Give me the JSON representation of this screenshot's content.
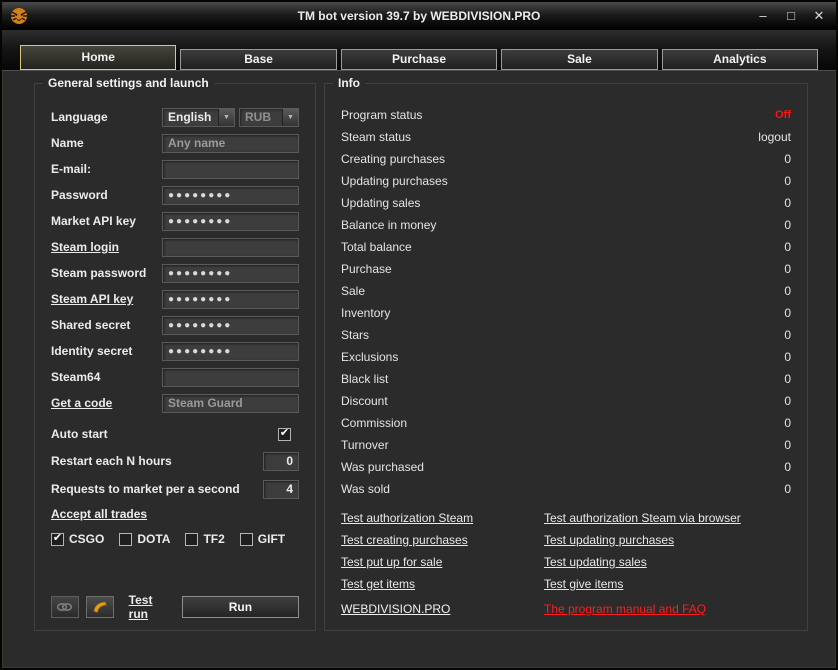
{
  "window": {
    "title": "TM bot version 39.7 by WEBDIVISION.PRO"
  },
  "icons": {
    "minimize": "–",
    "maximize": "□",
    "close": "✕",
    "dropdown_arrow": "▼",
    "check": "✔"
  },
  "tabs": [
    "Home",
    "Base",
    "Purchase",
    "Sale",
    "Analytics"
  ],
  "settings": {
    "title": "General settings and launch",
    "language_label": "Language",
    "language_value": "English",
    "currency_value": "RUB",
    "name_label": "Name",
    "name_value": "Any name",
    "email_label": "E-mail:",
    "email_value": "",
    "password_label": "Password",
    "password_value": "●●●●●●●●",
    "market_api_label": "Market API key",
    "market_api_value": "●●●●●●●●",
    "steam_login_label": "Steam login",
    "steam_login_value": "",
    "steam_password_label": "Steam password",
    "steam_password_value": "●●●●●●●●",
    "steam_api_label": "Steam API key",
    "steam_api_value": "●●●●●●●●",
    "shared_secret_label": "Shared secret",
    "shared_secret_value": "●●●●●●●●",
    "identity_secret_label": "Identity secret",
    "identity_secret_value": "●●●●●●●●",
    "steam64_label": "Steam64",
    "steam64_value": "",
    "get_code_label": "Get a code",
    "get_code_value": "Steam Guard",
    "autostart_label": "Auto start",
    "restart_label": "Restart each N hours",
    "restart_value": "0",
    "requests_label": "Requests to market per a second",
    "requests_value": "4",
    "accept_trades_label": "Accept all trades",
    "games": [
      {
        "label": "CSGO",
        "checked": true
      },
      {
        "label": "DOTA",
        "checked": false
      },
      {
        "label": "TF2",
        "checked": false
      },
      {
        "label": "GIFT",
        "checked": false
      }
    ],
    "test_run_label": "Test run",
    "run_label": "Run"
  },
  "info": {
    "title": "Info",
    "rows": [
      {
        "label": "Program status",
        "value": "Off"
      },
      {
        "label": "Steam status",
        "value": "logout"
      },
      {
        "label": "Creating purchases",
        "value": "0"
      },
      {
        "label": "Updating purchases",
        "value": "0"
      },
      {
        "label": "Updating sales",
        "value": "0"
      },
      {
        "label": "Balance in money",
        "value": "0"
      },
      {
        "label": "Total balance",
        "value": "0"
      },
      {
        "label": "Purchase",
        "value": "0"
      },
      {
        "label": "Sale",
        "value": "0"
      },
      {
        "label": "Inventory",
        "value": "0"
      },
      {
        "label": "Stars",
        "value": "0"
      },
      {
        "label": "Exclusions",
        "value": "0"
      },
      {
        "label": "Black list",
        "value": "0"
      },
      {
        "label": "Discount",
        "value": "0"
      },
      {
        "label": "Commission",
        "value": "0"
      },
      {
        "label": "Turnover",
        "value": "0"
      },
      {
        "label": "Was purchased",
        "value": "0"
      },
      {
        "label": "Was sold",
        "value": "0"
      }
    ],
    "links": [
      [
        "Test authorization Steam",
        "Test authorization Steam via browser"
      ],
      [
        "Test creating purchases",
        "Test updating purchases"
      ],
      [
        "Test put up for sale",
        "Test updating sales"
      ],
      [
        "Test get items",
        "Test give items"
      ]
    ],
    "site_link": "WEBDIVISION.PRO",
    "manual_link": "The program manual and FAQ"
  },
  "colors": {
    "status_off": "#ff1414",
    "manual_red": "#ff1e1e",
    "active_tab_border": "#d9c87e"
  }
}
